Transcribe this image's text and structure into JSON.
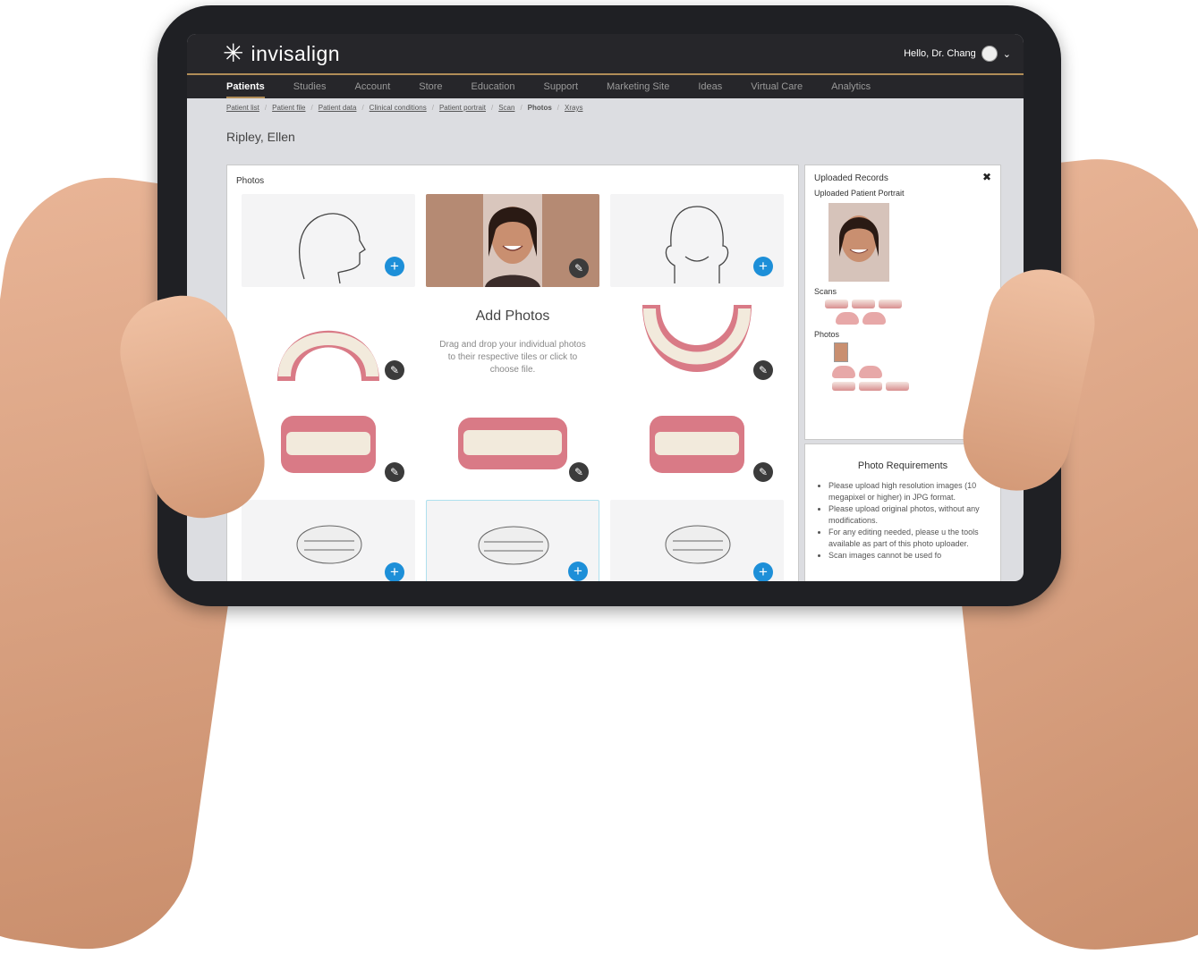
{
  "colors": {
    "accent_gold": "#b08d57",
    "plus_blue": "#1d8fd8",
    "topbar": "#26262a"
  },
  "app": {
    "logo_text": "invisalign",
    "logo_icon": "star-burst-icon",
    "greeting": "Hello, Dr. Chang"
  },
  "nav": {
    "items": [
      {
        "label": "Patients",
        "active": true
      },
      {
        "label": "Studies"
      },
      {
        "label": "Account"
      },
      {
        "label": "Store"
      },
      {
        "label": "Education"
      },
      {
        "label": "Support"
      },
      {
        "label": "Marketing Site"
      },
      {
        "label": "Ideas"
      },
      {
        "label": "Virtual Care"
      },
      {
        "label": "Analytics"
      }
    ]
  },
  "breadcrumbs": [
    "Patient list",
    "Patient file",
    "Patient data",
    "Clinical conditions",
    "Patient portrait",
    "Scan",
    "Photos",
    "Xrays"
  ],
  "patient": {
    "name": "Ripley, Ellen"
  },
  "photos_panel": {
    "title": "Photos",
    "add_title": "Add Photos",
    "add_desc": "Drag and drop your individual photos to their respective tiles or click to choose file."
  },
  "records": {
    "title": "Uploaded Records",
    "portrait_label": "Uploaded Patient Portrait",
    "scans_label": "Scans",
    "photos_label": "Photos"
  },
  "requirements": {
    "title": "Photo Requirements",
    "items": [
      "Please upload high resolution images (10 megapixel or higher) in JPG format.",
      "Please upload original photos, without any modifications.",
      "For any editing needed, please u the tools available as part of this photo uploader.",
      "Scan images cannot be used fo"
    ]
  }
}
